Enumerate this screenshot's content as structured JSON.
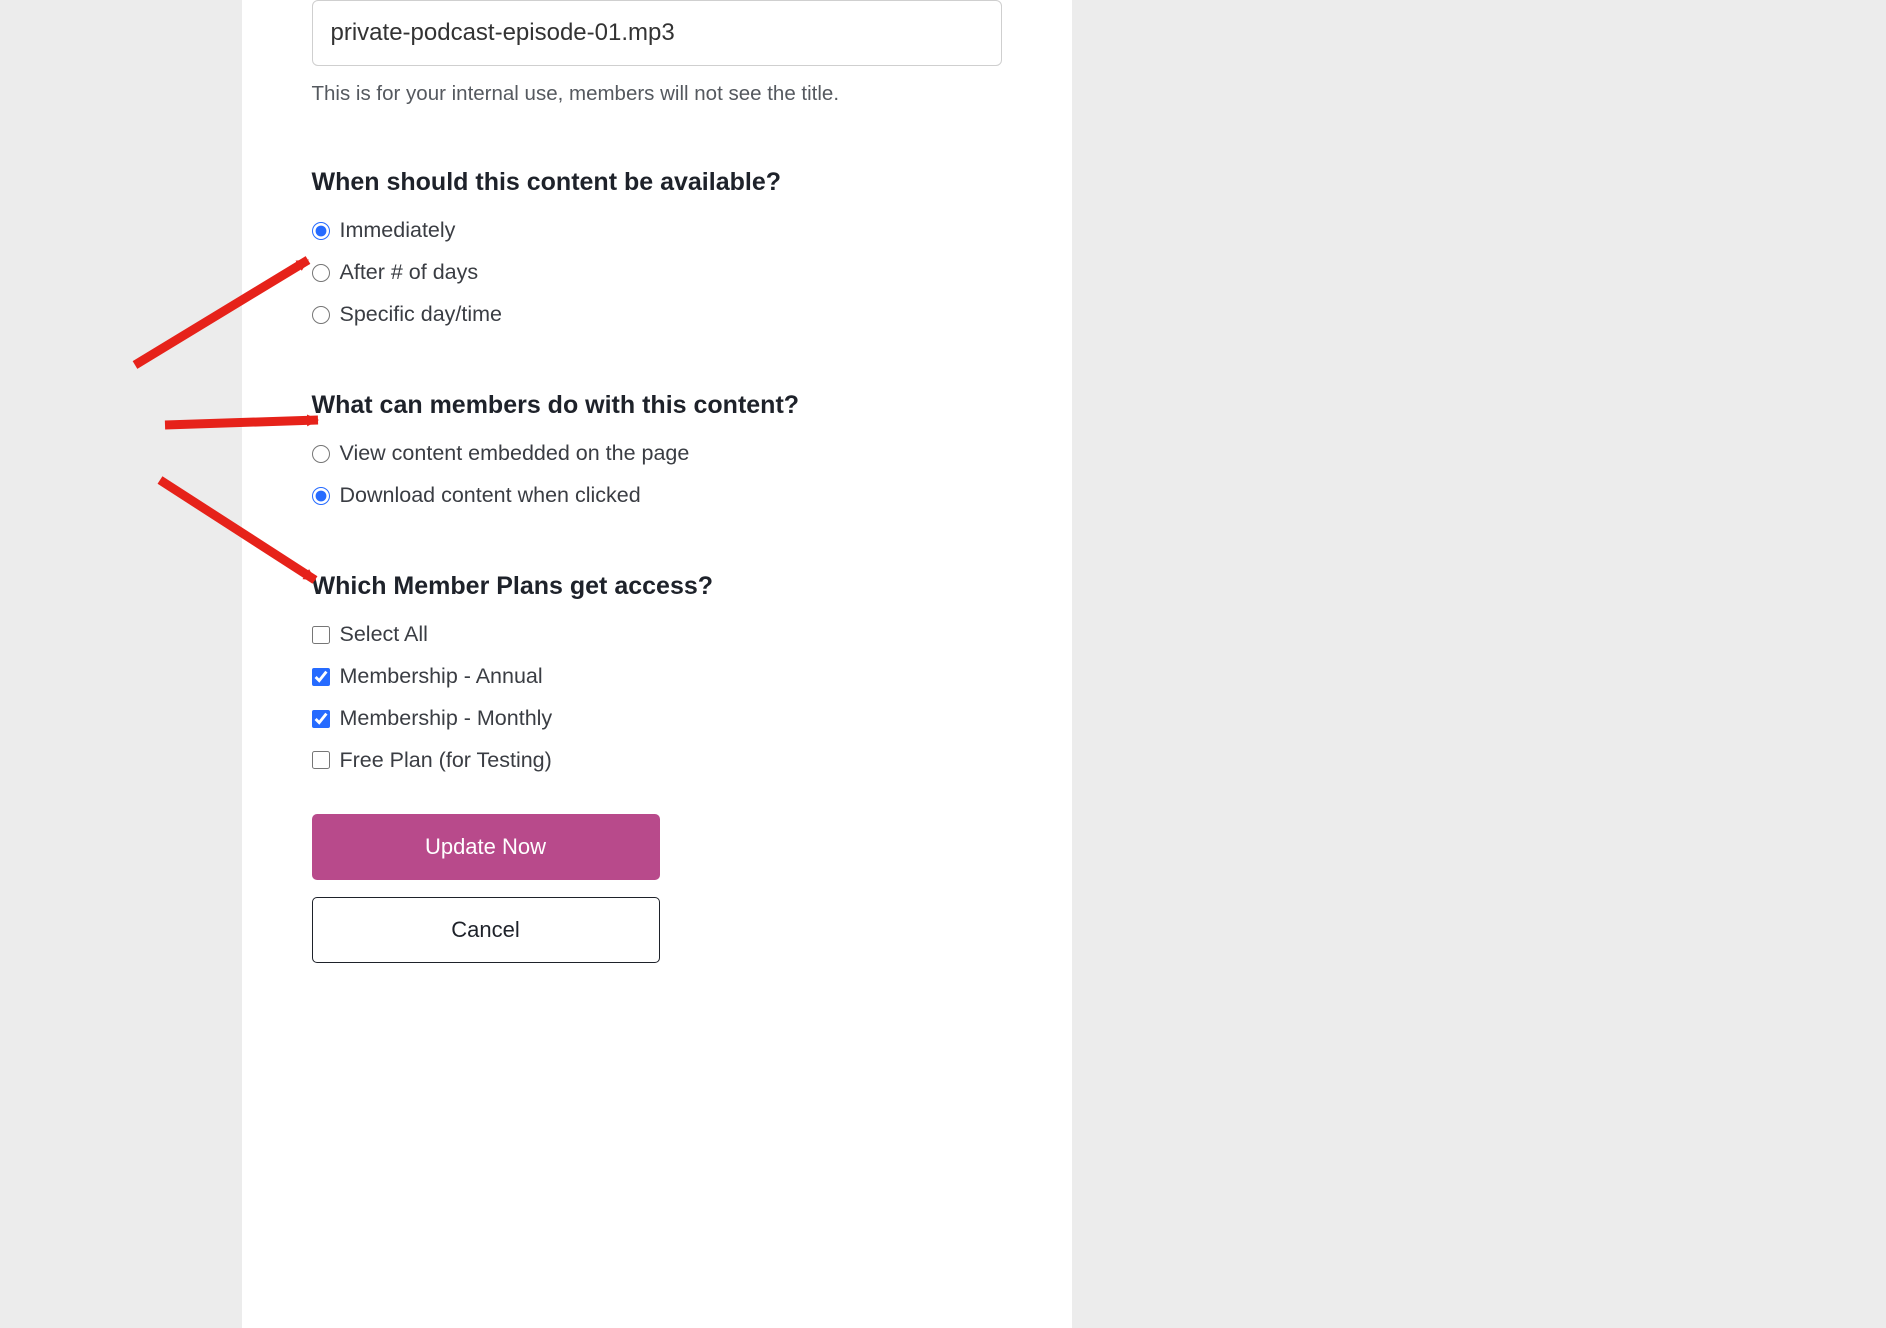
{
  "title_field": {
    "value": "private-podcast-episode-01.mp3",
    "help": "This is for your internal use, members will not see the title."
  },
  "availability": {
    "heading": "When should this content be available?",
    "options": [
      {
        "label": "Immediately",
        "checked": true
      },
      {
        "label": "After # of days",
        "checked": false
      },
      {
        "label": "Specific day/time",
        "checked": false
      }
    ]
  },
  "member_action": {
    "heading": "What can members do with this content?",
    "options": [
      {
        "label": "View content embedded on the page",
        "checked": false
      },
      {
        "label": "Download content when clicked",
        "checked": true
      }
    ]
  },
  "plans": {
    "heading": "Which Member Plans get access?",
    "options": [
      {
        "label": "Select All",
        "checked": false
      },
      {
        "label": "Membership - Annual",
        "checked": true
      },
      {
        "label": "Membership - Monthly",
        "checked": true
      },
      {
        "label": "Free Plan (for Testing)",
        "checked": false
      }
    ]
  },
  "buttons": {
    "primary": "Update Now",
    "secondary": "Cancel"
  },
  "colors": {
    "accent_pink": "#b84a8b",
    "arrow_red": "#e6221a"
  }
}
